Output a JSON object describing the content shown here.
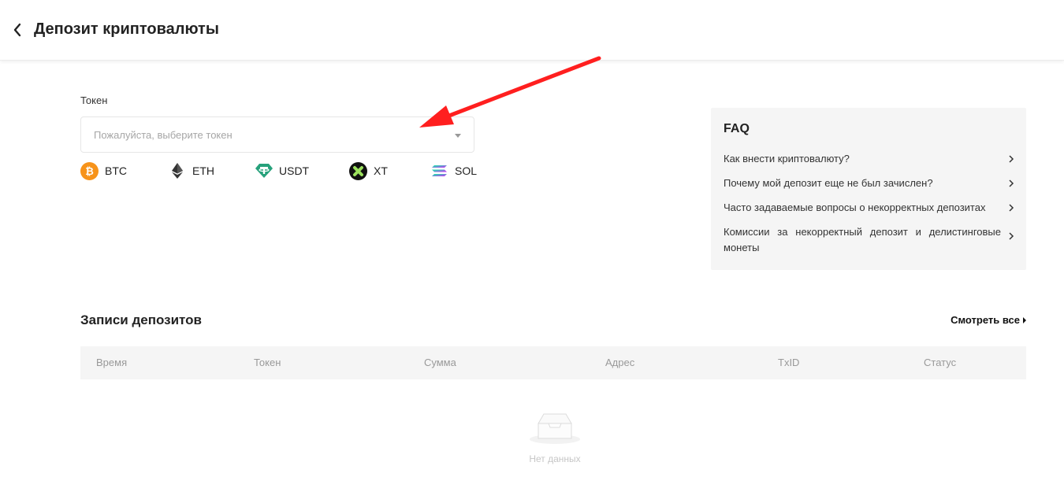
{
  "header": {
    "title": "Депозит криптовалюты"
  },
  "token": {
    "label": "Токен",
    "placeholder": "Пожалуйста, выберите токен",
    "quick": [
      {
        "symbol": "BTC",
        "icon": "bitcoin-icon",
        "color": "#f7931a"
      },
      {
        "symbol": "ETH",
        "icon": "ethereum-icon",
        "color": "#343434"
      },
      {
        "symbol": "USDT",
        "icon": "tether-icon",
        "color": "#26a17b"
      },
      {
        "symbol": "XT",
        "icon": "xt-icon",
        "color": "#111111"
      },
      {
        "symbol": "SOL",
        "icon": "solana-icon",
        "color": "#9945ff"
      }
    ]
  },
  "faq": {
    "title": "FAQ",
    "items": [
      "Как внести криптовалюту?",
      "Почему мой депозит еще не был зачислен?",
      "Часто задаваемые вопросы о некорректных депозитах",
      "Комиссии за некорректный депозит и делистинговые монеты"
    ]
  },
  "records": {
    "title": "Записи депозитов",
    "view_all": "Смотреть все",
    "columns": [
      "Время",
      "Токен",
      "Сумма",
      "Адрес",
      "TxID",
      "Статус"
    ],
    "empty_text": "Нет данных"
  },
  "colors": {
    "annotation_arrow": "#ff1f1f",
    "panel_bg": "#f5f5f5"
  }
}
